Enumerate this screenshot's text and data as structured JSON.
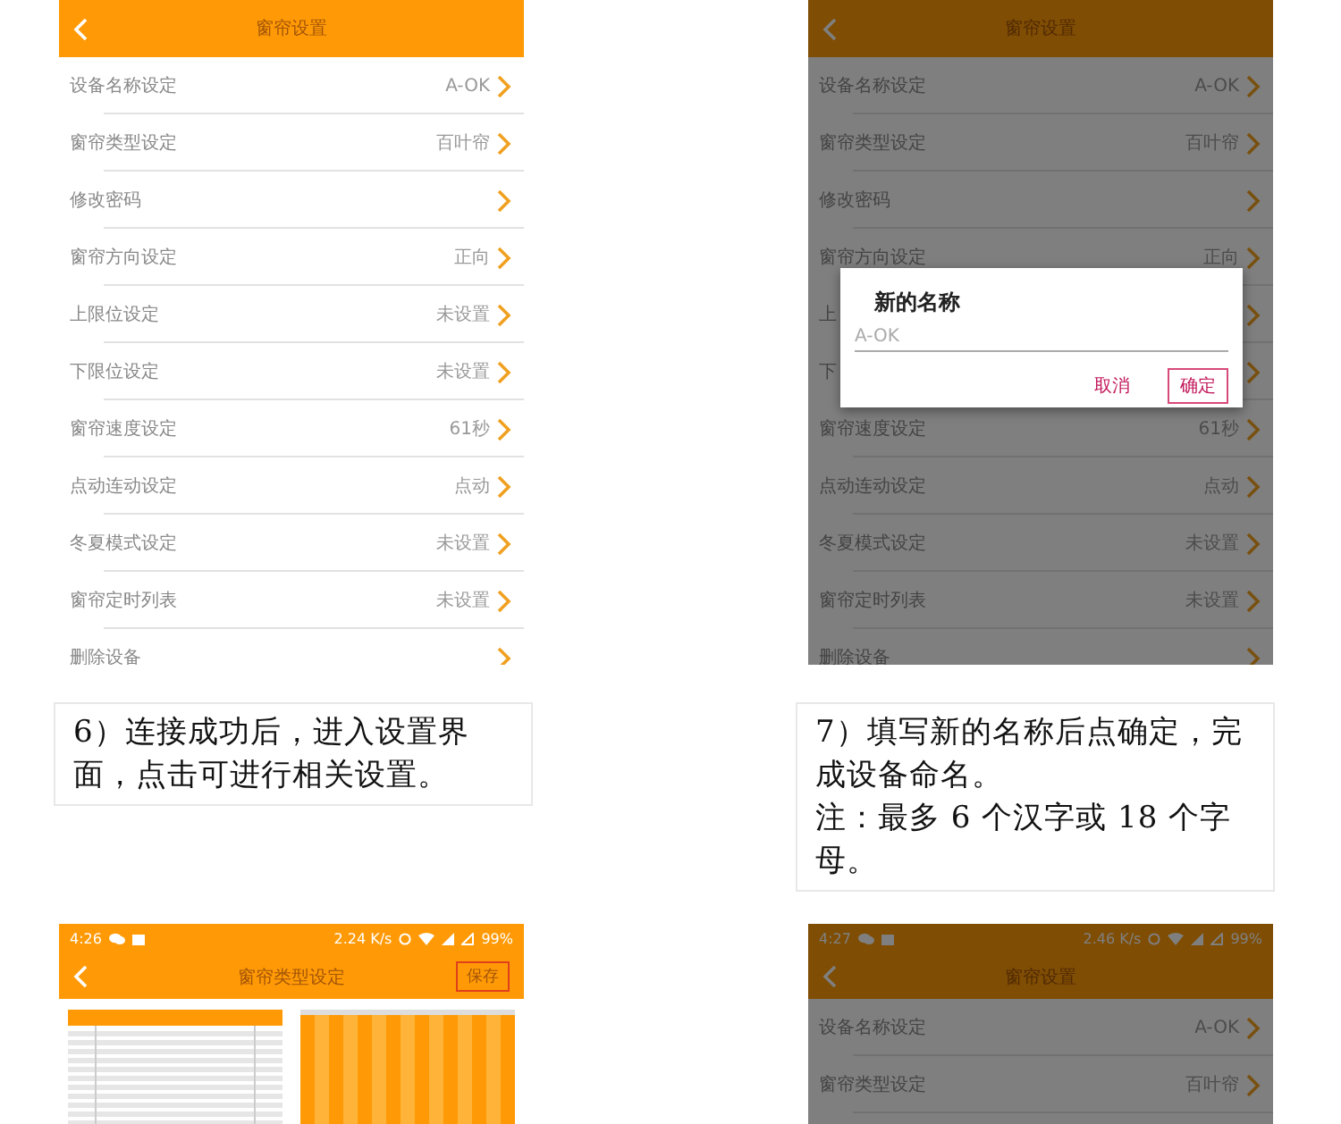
{
  "screens": [
    {
      "kind": "settings",
      "dimmed": false,
      "title": "窗帘设置",
      "rows": [
        {
          "label": "设备名称设定",
          "value": "A-OK"
        },
        {
          "label": "窗帘类型设定",
          "value": "百叶帘"
        },
        {
          "label": "修改密码"
        },
        {
          "label": "窗帘方向设定",
          "value": "正向"
        },
        {
          "label": "上限位设定",
          "value": "未设置"
        },
        {
          "label": "下限位设定",
          "value": "未设置"
        },
        {
          "label": "窗帘速度设定",
          "value": "61秒"
        },
        {
          "label": "点动连动设定",
          "value": "点动"
        },
        {
          "label": "冬夏模式设定",
          "value": "未设置"
        },
        {
          "label": "窗帘定时列表",
          "value": "未设置"
        },
        {
          "label": "删除设备"
        }
      ]
    },
    {
      "kind": "settings",
      "dimmed": true,
      "title": "窗帘设置",
      "rows": [
        {
          "label": "设备名称设定",
          "value": "A-OK"
        },
        {
          "label": "窗帘类型设定",
          "value": "百叶帘"
        },
        {
          "label": "修改密码"
        },
        {
          "label": "窗帘方向设定",
          "value": "正向"
        },
        {
          "label": "上"
        },
        {
          "label": "下"
        },
        {
          "label": "窗帘速度设定",
          "value": "61秒"
        },
        {
          "label": "点动连动设定",
          "value": "点动"
        },
        {
          "label": "冬夏模式设定",
          "value": "未设置"
        },
        {
          "label": "窗帘定时列表",
          "value": "未设置"
        },
        {
          "label": "删除设备"
        }
      ],
      "dialog": {
        "title": "新的名称",
        "placeholder": "A-OK",
        "buttons": [
          {
            "label": "取消",
            "selected": false
          },
          {
            "label": "确定",
            "selected": true
          }
        ]
      }
    },
    {
      "kind": "type_picker",
      "dimmed": false,
      "status": {
        "time": "4:26",
        "speed": "2.24 K/s",
        "battery": "99%"
      },
      "title": "窗帘类型设定",
      "save": "保存",
      "options": [
        {
          "kind": "venetian"
        },
        {
          "kind": "vertical"
        }
      ]
    },
    {
      "kind": "settings",
      "dimmed": true,
      "status": {
        "time": "4:27",
        "speed": "2.46 K/s",
        "battery": "99%"
      },
      "title": "窗帘设置",
      "rows": [
        {
          "label": "设备名称设定",
          "value": "A-OK"
        },
        {
          "label": "窗帘类型设定",
          "value": "百叶帘"
        }
      ]
    }
  ],
  "captions": [
    {
      "paragraphs": [
        "6）连接成功后，进入设置界面，点击可进行相关设置。"
      ]
    },
    {
      "paragraphs": [
        "7）填写新的名称后点确定，完成设备命名。",
        "注：最多 6 个汉字或 18 个字母。"
      ]
    }
  ]
}
